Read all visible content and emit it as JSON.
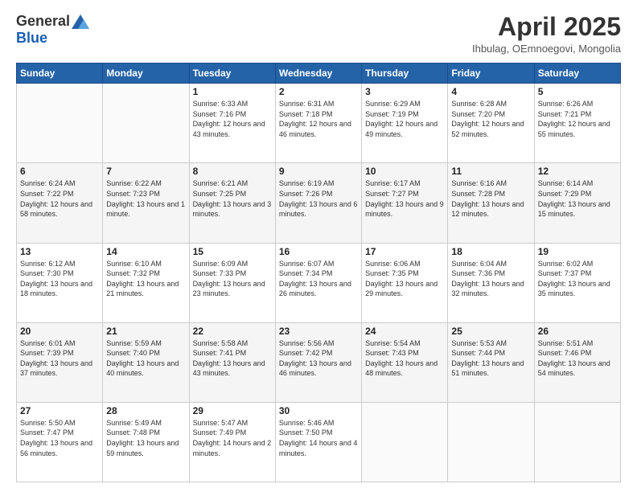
{
  "logo": {
    "general": "General",
    "blue": "Blue"
  },
  "title": "April 2025",
  "subtitle": "Ihbulag, OEmnoegovi, Mongolia",
  "days": [
    "Sunday",
    "Monday",
    "Tuesday",
    "Wednesday",
    "Thursday",
    "Friday",
    "Saturday"
  ],
  "weeks": [
    [
      {
        "day": "",
        "info": ""
      },
      {
        "day": "",
        "info": ""
      },
      {
        "day": "1",
        "info": "Sunrise: 6:33 AM\nSunset: 7:16 PM\nDaylight: 12 hours and 43 minutes."
      },
      {
        "day": "2",
        "info": "Sunrise: 6:31 AM\nSunset: 7:18 PM\nDaylight: 12 hours and 46 minutes."
      },
      {
        "day": "3",
        "info": "Sunrise: 6:29 AM\nSunset: 7:19 PM\nDaylight: 12 hours and 49 minutes."
      },
      {
        "day": "4",
        "info": "Sunrise: 6:28 AM\nSunset: 7:20 PM\nDaylight: 12 hours and 52 minutes."
      },
      {
        "day": "5",
        "info": "Sunrise: 6:26 AM\nSunset: 7:21 PM\nDaylight: 12 hours and 55 minutes."
      }
    ],
    [
      {
        "day": "6",
        "info": "Sunrise: 6:24 AM\nSunset: 7:22 PM\nDaylight: 12 hours and 58 minutes."
      },
      {
        "day": "7",
        "info": "Sunrise: 6:22 AM\nSunset: 7:23 PM\nDaylight: 13 hours and 1 minute."
      },
      {
        "day": "8",
        "info": "Sunrise: 6:21 AM\nSunset: 7:25 PM\nDaylight: 13 hours and 3 minutes."
      },
      {
        "day": "9",
        "info": "Sunrise: 6:19 AM\nSunset: 7:26 PM\nDaylight: 13 hours and 6 minutes."
      },
      {
        "day": "10",
        "info": "Sunrise: 6:17 AM\nSunset: 7:27 PM\nDaylight: 13 hours and 9 minutes."
      },
      {
        "day": "11",
        "info": "Sunrise: 6:16 AM\nSunset: 7:28 PM\nDaylight: 13 hours and 12 minutes."
      },
      {
        "day": "12",
        "info": "Sunrise: 6:14 AM\nSunset: 7:29 PM\nDaylight: 13 hours and 15 minutes."
      }
    ],
    [
      {
        "day": "13",
        "info": "Sunrise: 6:12 AM\nSunset: 7:30 PM\nDaylight: 13 hours and 18 minutes."
      },
      {
        "day": "14",
        "info": "Sunrise: 6:10 AM\nSunset: 7:32 PM\nDaylight: 13 hours and 21 minutes."
      },
      {
        "day": "15",
        "info": "Sunrise: 6:09 AM\nSunset: 7:33 PM\nDaylight: 13 hours and 23 minutes."
      },
      {
        "day": "16",
        "info": "Sunrise: 6:07 AM\nSunset: 7:34 PM\nDaylight: 13 hours and 26 minutes."
      },
      {
        "day": "17",
        "info": "Sunrise: 6:06 AM\nSunset: 7:35 PM\nDaylight: 13 hours and 29 minutes."
      },
      {
        "day": "18",
        "info": "Sunrise: 6:04 AM\nSunset: 7:36 PM\nDaylight: 13 hours and 32 minutes."
      },
      {
        "day": "19",
        "info": "Sunrise: 6:02 AM\nSunset: 7:37 PM\nDaylight: 13 hours and 35 minutes."
      }
    ],
    [
      {
        "day": "20",
        "info": "Sunrise: 6:01 AM\nSunset: 7:39 PM\nDaylight: 13 hours and 37 minutes."
      },
      {
        "day": "21",
        "info": "Sunrise: 5:59 AM\nSunset: 7:40 PM\nDaylight: 13 hours and 40 minutes."
      },
      {
        "day": "22",
        "info": "Sunrise: 5:58 AM\nSunset: 7:41 PM\nDaylight: 13 hours and 43 minutes."
      },
      {
        "day": "23",
        "info": "Sunrise: 5:56 AM\nSunset: 7:42 PM\nDaylight: 13 hours and 46 minutes."
      },
      {
        "day": "24",
        "info": "Sunrise: 5:54 AM\nSunset: 7:43 PM\nDaylight: 13 hours and 48 minutes."
      },
      {
        "day": "25",
        "info": "Sunrise: 5:53 AM\nSunset: 7:44 PM\nDaylight: 13 hours and 51 minutes."
      },
      {
        "day": "26",
        "info": "Sunrise: 5:51 AM\nSunset: 7:46 PM\nDaylight: 13 hours and 54 minutes."
      }
    ],
    [
      {
        "day": "27",
        "info": "Sunrise: 5:50 AM\nSunset: 7:47 PM\nDaylight: 13 hours and 56 minutes."
      },
      {
        "day": "28",
        "info": "Sunrise: 5:49 AM\nSunset: 7:48 PM\nDaylight: 13 hours and 59 minutes."
      },
      {
        "day": "29",
        "info": "Sunrise: 5:47 AM\nSunset: 7:49 PM\nDaylight: 14 hours and 2 minutes."
      },
      {
        "day": "30",
        "info": "Sunrise: 5:46 AM\nSunset: 7:50 PM\nDaylight: 14 hours and 4 minutes."
      },
      {
        "day": "",
        "info": ""
      },
      {
        "day": "",
        "info": ""
      },
      {
        "day": "",
        "info": ""
      }
    ]
  ]
}
